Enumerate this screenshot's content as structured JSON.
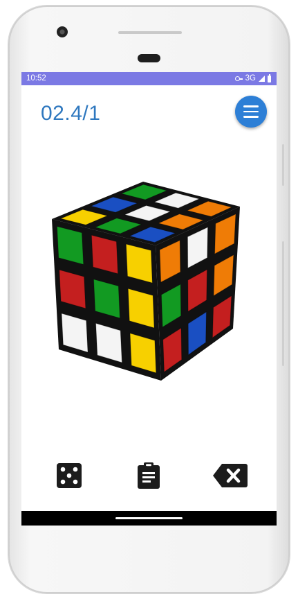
{
  "status_bar": {
    "time": "10:52",
    "network": "3G",
    "icons": [
      "vpn-key-icon",
      "signal-icon",
      "battery-icon"
    ],
    "background": "#7b79e4"
  },
  "header": {
    "counter": "02.4/1",
    "counter_color": "#2f78bf",
    "menu_icon": "hamburger-menu-icon",
    "menu_button_color": "#2d7fd6"
  },
  "cube": {
    "top_face": [
      [
        "green",
        "white",
        "orange"
      ],
      [
        "blue",
        "white",
        "orange"
      ],
      [
        "yellow",
        "green",
        "blue"
      ]
    ],
    "front_face": [
      [
        "green",
        "red",
        "yellow"
      ],
      [
        "red",
        "green",
        "yellow"
      ],
      [
        "white",
        "white",
        "yellow"
      ]
    ],
    "right_face": [
      [
        "orange",
        "white",
        "orange"
      ],
      [
        "green",
        "red",
        "orange"
      ],
      [
        "red",
        "blue",
        "red"
      ]
    ],
    "colors": {
      "white": "#f4f4f4",
      "yellow": "#f7d000",
      "red": "#c41f1f",
      "orange": "#ef7c06",
      "blue": "#1a4fc2",
      "green": "#129a22"
    }
  },
  "toolbar": {
    "icons": [
      "dice-icon",
      "clipboard-icon",
      "backspace-icon"
    ]
  }
}
